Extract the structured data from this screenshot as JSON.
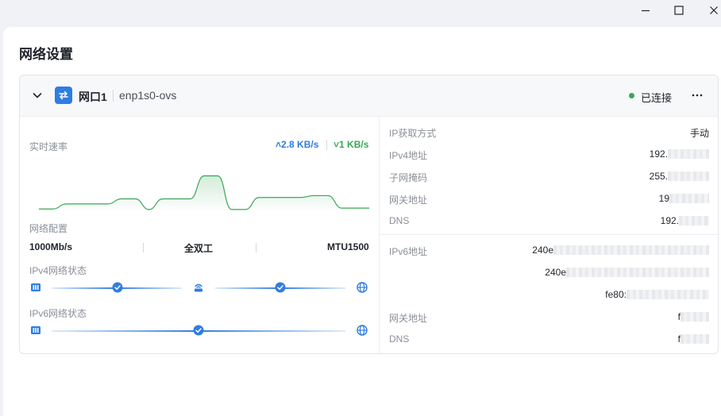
{
  "window_controls": {
    "minimize_icon": "minimize-icon",
    "maximize_icon": "maximize-icon",
    "close_icon": "close-icon"
  },
  "page": {
    "title": "网络设置"
  },
  "port": {
    "name": "网口1",
    "device": "enp1s0-ovs",
    "status": "已连接",
    "status_color": "#3aa655",
    "accent_color": "#2f7de1"
  },
  "speed": {
    "label": "实时速率",
    "upload": "2.8 KB/s",
    "download": "1 KB/s",
    "chart_data": {
      "type": "area",
      "series": [
        {
          "values": [
            0.03,
            0.03,
            0.14,
            0.14,
            0.14,
            0.14,
            0.25,
            0.25,
            0.02,
            0.25,
            0.25,
            0.25,
            0.75,
            0.75,
            0.02,
            0.02,
            0.28,
            0.28,
            0.28,
            0.28,
            0.32,
            0.32,
            0.05,
            0.05,
            0.05
          ]
        }
      ]
    }
  },
  "network_config": {
    "label": "网络配置",
    "speed": "1000Mb/s",
    "duplex": "全双工",
    "mtu": "MTU1500"
  },
  "ipv4_status": {
    "label": "IPv4网络状态"
  },
  "ipv6_status": {
    "label": "IPv6网络状态"
  },
  "details": {
    "ip_method_label": "IP获取方式",
    "ip_method_value": "手动",
    "ipv4_label": "IPv4地址",
    "ipv4_value": "192.",
    "mask_label": "子网掩码",
    "mask_value": "255.",
    "gateway_label": "网关地址",
    "gateway_value": "19",
    "dns_label": "DNS",
    "dns_value": "192.",
    "ipv6_label": "IPv6地址",
    "ipv6_values": [
      "240e",
      "240e",
      "fe80:"
    ],
    "gateway6_label": "网关地址",
    "gateway6_value": "f",
    "dns6_label": "DNS",
    "dns6_value": "f"
  }
}
